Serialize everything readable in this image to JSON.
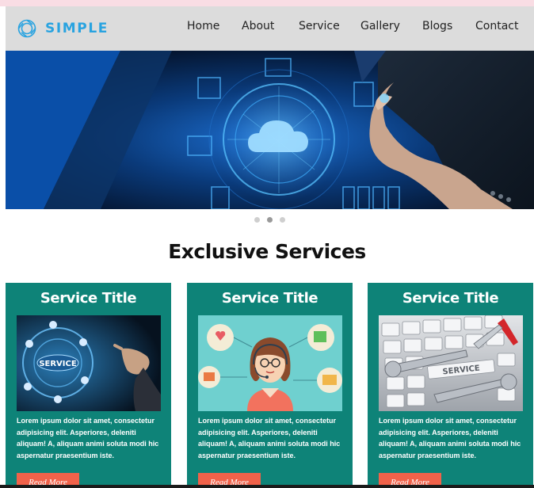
{
  "brand": {
    "name": "SIMPLE",
    "color": "#29a3e0"
  },
  "nav": {
    "items": [
      {
        "label": "Home"
      },
      {
        "label": "About"
      },
      {
        "label": "Service"
      },
      {
        "label": "Gallery"
      },
      {
        "label": "Blogs"
      },
      {
        "label": "Contact"
      }
    ]
  },
  "hero": {
    "image": "cloud-computing-hand-touch-image",
    "slides": 3,
    "active_slide": 2
  },
  "services": {
    "heading": "Exclusive Services",
    "cards": [
      {
        "title": "Service Title",
        "image": "digital-service-hand-image",
        "text": "Lorem ipsum dolor sit amet, consectetur adipisicing elit. Asperiores, deleniti aliquam! A, aliquam animi soluta modi hic aspernatur praesentium iste.",
        "button": "Read More"
      },
      {
        "title": "Service Title",
        "image": "customer-support-agent-image",
        "text": "Lorem ipsum dolor sit amet, consectetur adipisicing elit. Asperiores, deleniti aliquam! A, aliquam animi soluta modi hic aspernatur praesentium iste.",
        "button": "Read More"
      },
      {
        "title": "Service Title",
        "image": "keyboard-wrench-service-image",
        "text": "Lorem ipsum dolor sit amet, consectetur adipisicing elit. Asperiores, deleniti aliquam! A, aliquam animi soluta modi hic aspernatur praesentium iste.",
        "button": "Read More"
      }
    ]
  },
  "colors": {
    "card_bg": "#0e8378",
    "button_bg": "#f0624a",
    "nav_bg": "#dcdcdc"
  }
}
